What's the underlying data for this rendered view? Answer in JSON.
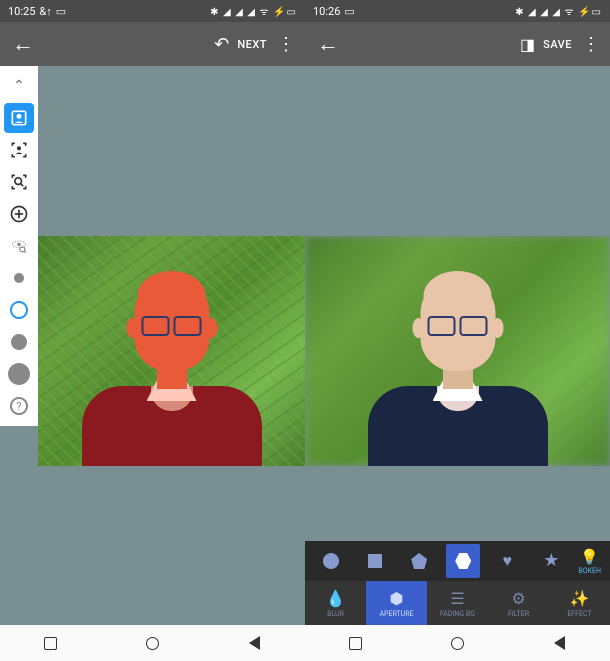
{
  "left_screen": {
    "status": {
      "time": "10:25",
      "extra": "&↑",
      "icons": "✱ ◢ ◢ ◢ ᯤ ⚡▭"
    },
    "topbar": {
      "action": "NEXT"
    },
    "tools": {
      "chevron": "chevron-up",
      "items": [
        {
          "name": "face-detect",
          "active": true
        },
        {
          "name": "object-detect",
          "active": false
        },
        {
          "name": "zoom-detect",
          "active": false
        },
        {
          "name": "add-circle",
          "active": false
        },
        {
          "name": "eye-zoom",
          "active": false
        }
      ],
      "brushes": [
        {
          "size": "small-gray",
          "active": false
        },
        {
          "size": "white-active",
          "active": true
        },
        {
          "size": "med-gray",
          "active": false
        },
        {
          "size": "large-gray",
          "active": false
        }
      ],
      "help": "?"
    }
  },
  "right_screen": {
    "status": {
      "time": "10:26",
      "icons": "✱ ◢ ◢ ◢ ᯤ ⚡▭"
    },
    "topbar": {
      "action": "SAVE"
    },
    "shapes": [
      {
        "name": "circle",
        "active": false
      },
      {
        "name": "square",
        "active": false
      },
      {
        "name": "pentagon",
        "active": false
      },
      {
        "name": "hexagon",
        "active": true
      },
      {
        "name": "heart",
        "active": false
      },
      {
        "name": "star",
        "active": false
      }
    ],
    "bokeh_label": "BOKEH",
    "tabs": [
      {
        "label": "BLUR",
        "icon": "💧",
        "active": false
      },
      {
        "label": "APERTURE",
        "icon": "⬢",
        "active": true
      },
      {
        "label": "FADING BG",
        "icon": "▬",
        "active": false
      },
      {
        "label": "FILTER",
        "icon": "⚙",
        "active": false
      },
      {
        "label": "EFFECT",
        "icon": "✨",
        "active": false
      }
    ]
  }
}
